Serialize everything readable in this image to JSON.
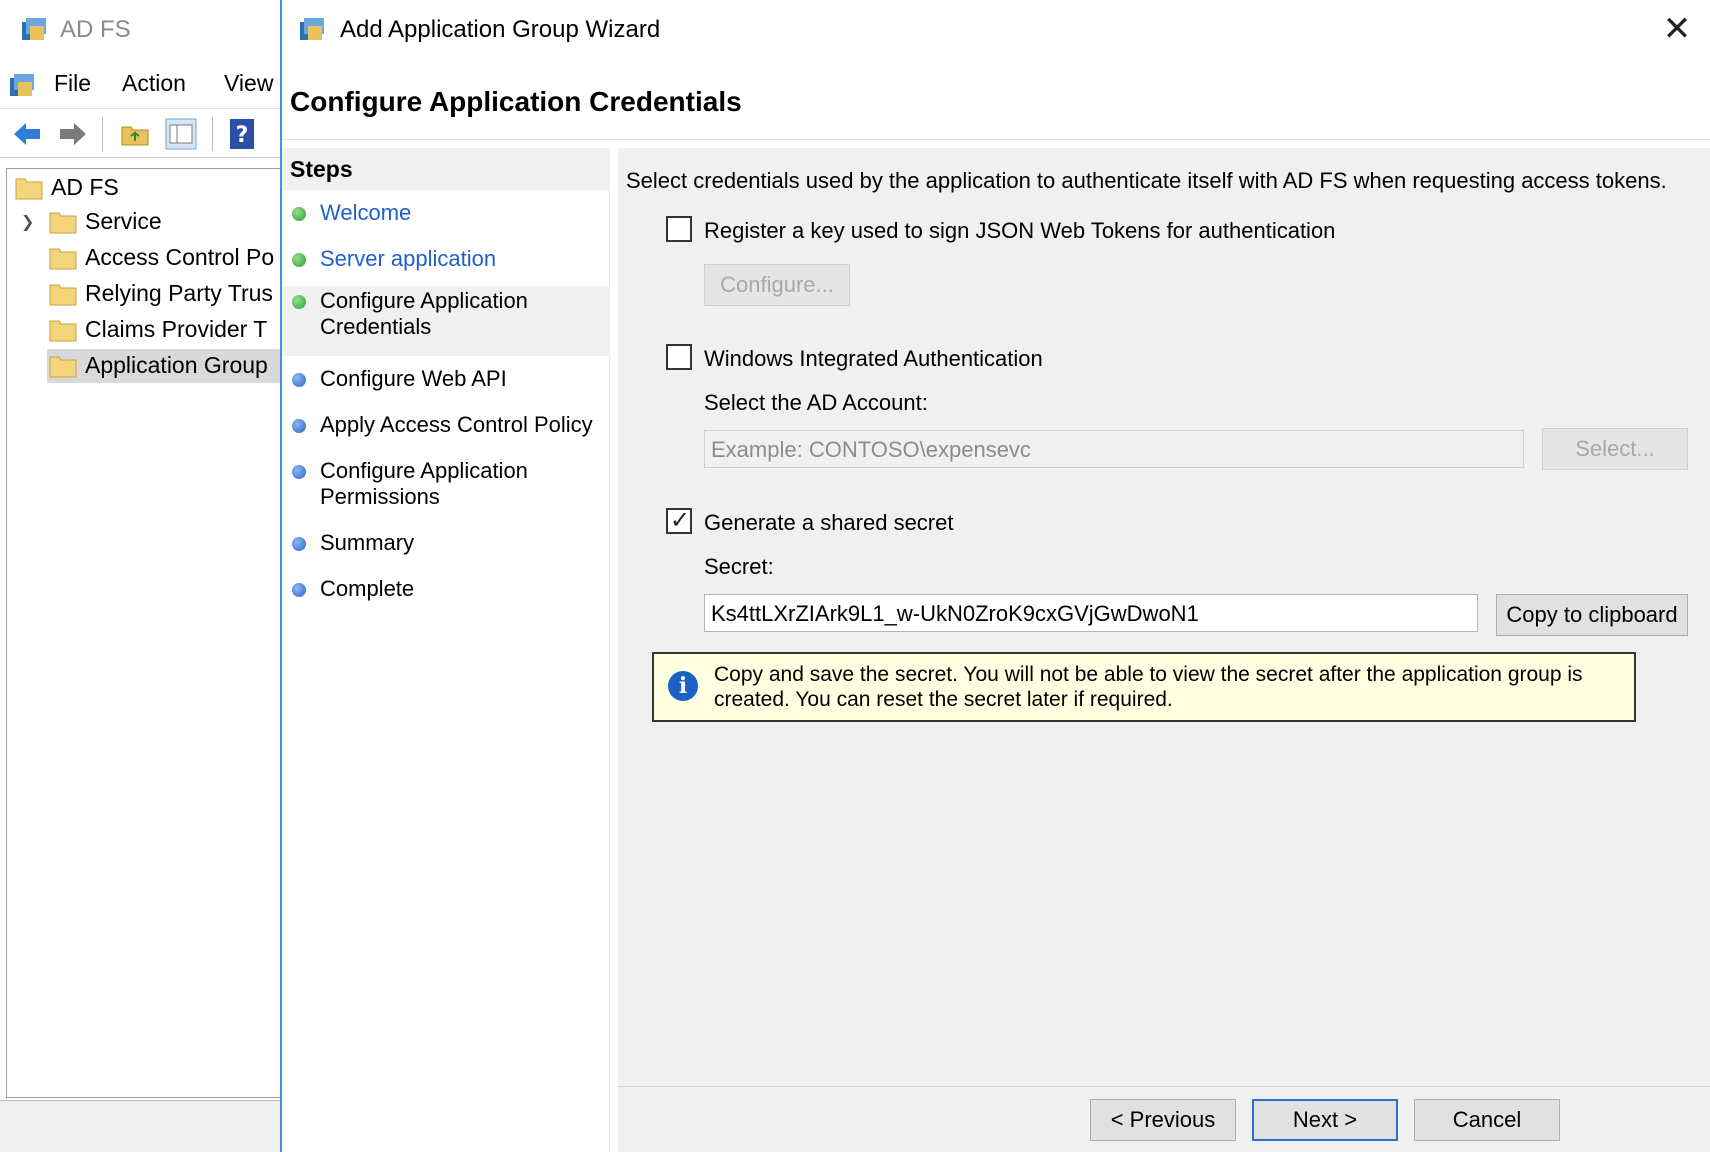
{
  "mmc": {
    "title": "AD FS",
    "menu": [
      "File",
      "Action",
      "View"
    ],
    "tree": {
      "root": "AD FS",
      "items": [
        "Service",
        "Access Control Po",
        "Relying Party Trus",
        "Claims Provider T",
        "Application Group"
      ]
    }
  },
  "wizard": {
    "title": "Add Application Group Wizard",
    "heading": "Configure Application Credentials",
    "steps_header": "Steps",
    "steps": [
      {
        "label": "Welcome",
        "state": "done-link"
      },
      {
        "label": "Server application",
        "state": "done-link"
      },
      {
        "label": "Configure Application Credentials",
        "state": "current"
      },
      {
        "label": "Configure Web API",
        "state": "pending"
      },
      {
        "label": "Apply Access Control Policy",
        "state": "pending"
      },
      {
        "label": "Configure Application Permissions",
        "state": "pending"
      },
      {
        "label": "Summary",
        "state": "pending"
      },
      {
        "label": "Complete",
        "state": "pending"
      }
    ],
    "intro": "Select credentials used by the application to authenticate itself with AD FS when requesting access tokens.",
    "jwt": {
      "label": "Register a key used to sign JSON Web Tokens for authentication",
      "checked": false,
      "configure_label": "Configure..."
    },
    "wia": {
      "label": "Windows Integrated Authentication",
      "checked": false,
      "account_label": "Select the AD Account:",
      "account_placeholder": "Example: CONTOSO\\expensevc",
      "select_label": "Select..."
    },
    "secret": {
      "label": "Generate a shared secret",
      "checked": true,
      "secret_label": "Secret:",
      "value": "Ks4ttLXrZIArk9L1_w-UkN0ZroK9cxGVjGwDwoN1",
      "copy_label": "Copy to clipboard",
      "info": "Copy and save the secret.  You will not be able to view the secret after the application group is created.  You can reset the secret later if required."
    },
    "footer": {
      "previous": "< Previous",
      "next": "Next >",
      "cancel": "Cancel"
    },
    "colors": {
      "link": "#1f5fd0",
      "info_bg": "#ffffe1",
      "accent": "#2a6fd6"
    }
  }
}
